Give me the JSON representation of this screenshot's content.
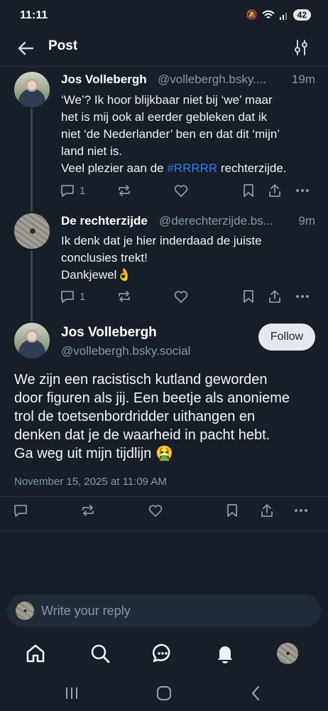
{
  "status_bar": {
    "time": "11:11",
    "battery": "42"
  },
  "header": {
    "title": "Post"
  },
  "thread": [
    {
      "author": "Jos Vollebergh",
      "handle": "@vollebergh.bsky....",
      "age": "19m",
      "text_before": "‘We’? Ik hoor blijkbaar niet bij ‘we’ maar\nhet is mij ook al eerder gebleken dat ik\nniet ‘de Nederlander’ ben en dat dit ‘mijn’\nland niet is.\nVeel plezier aan de ",
      "hashtag": "#RRRRR",
      "text_after": " rechterzijde.",
      "reply_count": "1"
    },
    {
      "author": "De rechterzijde",
      "handle": "@derechterzijde.bs...",
      "age": "9m",
      "text": "Ik denk dat je hier inderdaad de juiste\nconclusies trekt!\nDankjewel👌",
      "reply_count": "1"
    }
  ],
  "main_post": {
    "author": "Jos Vollebergh",
    "handle": "@vollebergh.bsky.social",
    "follow_label": "Follow",
    "text": "We zijn een racistisch kutland geworden\ndoor figuren als jij. Een beetje als anonieme\ntrol de toetsenbordridder uithangen en\ndenken dat je de waarheid in pacht hebt.\nGa weg uit mijn tijdlijn 🤮",
    "timestamp": "November 15, 2025 at 11:09 AM"
  },
  "reply": {
    "placeholder": "Write your reply"
  },
  "colors": {
    "background": "#161e27",
    "accent": "#2f7cf6",
    "muted": "#8a97a8"
  },
  "tabs": [
    "home-icon",
    "search-icon",
    "chat-icon",
    "bell-icon",
    "profile-avatar"
  ]
}
